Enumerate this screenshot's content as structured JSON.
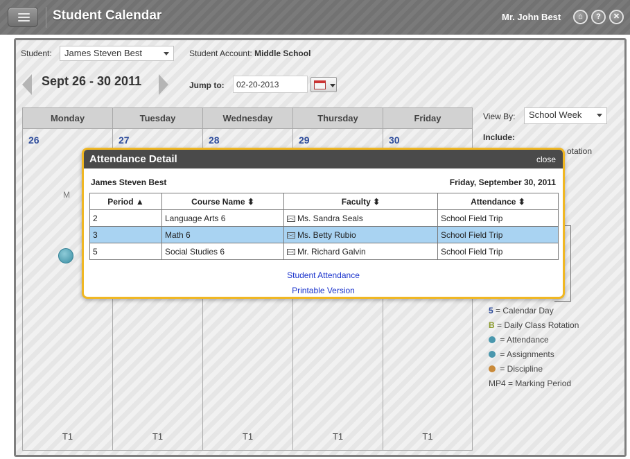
{
  "titlebar": {
    "title": "Student Calendar",
    "user": "Mr. John Best",
    "icons": [
      "home-icon",
      "help-icon",
      "close-icon"
    ]
  },
  "student_bar": {
    "student_label": "Student:",
    "student_value": "James Steven Best",
    "account_label": "Student Account:",
    "account_value": "Middle School"
  },
  "week": {
    "label": "Sept 26 - 30 2011",
    "jump_label": "Jump to:",
    "jump_value": "02-20-2013"
  },
  "days": [
    {
      "name": "Monday",
      "num": "26",
      "term": "T1"
    },
    {
      "name": "Tuesday",
      "num": "27",
      "term": "T1"
    },
    {
      "name": "Wednesday",
      "num": "28",
      "term": "T1"
    },
    {
      "name": "Thursday",
      "num": "29",
      "term": "T1"
    },
    {
      "name": "Friday",
      "num": "30",
      "term": "T1"
    }
  ],
  "monday_letter": "M",
  "side": {
    "view_by_label": "View By:",
    "view_by_value": "School Week",
    "include_label": "Include:",
    "include_partial": "otation",
    "legend": [
      {
        "key": "5",
        "text": " = Calendar Day",
        "key_color": "#2f4d9c"
      },
      {
        "key": "B",
        "text": " = Daily Class Rotation",
        "key_color": "#8a9a2a"
      },
      {
        "key": "",
        "text": " = Attendance",
        "dot_color": "#4a97ad"
      },
      {
        "key": "",
        "text": " = Assignments",
        "dot_color": "#4a97ad"
      },
      {
        "key": "",
        "text": " = Discipline",
        "dot_color": "#c98a3a"
      },
      {
        "key": "MP4",
        "text": " = Marking Period",
        "key_color": "#444"
      }
    ]
  },
  "popup": {
    "title": "Attendance Detail",
    "close": "close",
    "student": "James Steven Best",
    "date": "Friday, September 30, 2011",
    "headers": {
      "period": "Period ▲",
      "course": "Course Name ⬍",
      "faculty": "Faculty ⬍",
      "attendance": "Attendance ⬍"
    },
    "rows": [
      {
        "period": "2",
        "course": "Language Arts 6",
        "faculty": "Ms. Sandra Seals",
        "attendance": "School Field Trip"
      },
      {
        "period": "3",
        "course": "Math 6",
        "faculty": "Ms. Betty Rubio",
        "attendance": "School Field Trip"
      },
      {
        "period": "5",
        "course": "Social Studies 6",
        "faculty": "Mr. Richard Galvin",
        "attendance": "School Field Trip"
      }
    ],
    "links": {
      "student_attendance": "Student Attendance",
      "printable": "Printable Version"
    }
  }
}
